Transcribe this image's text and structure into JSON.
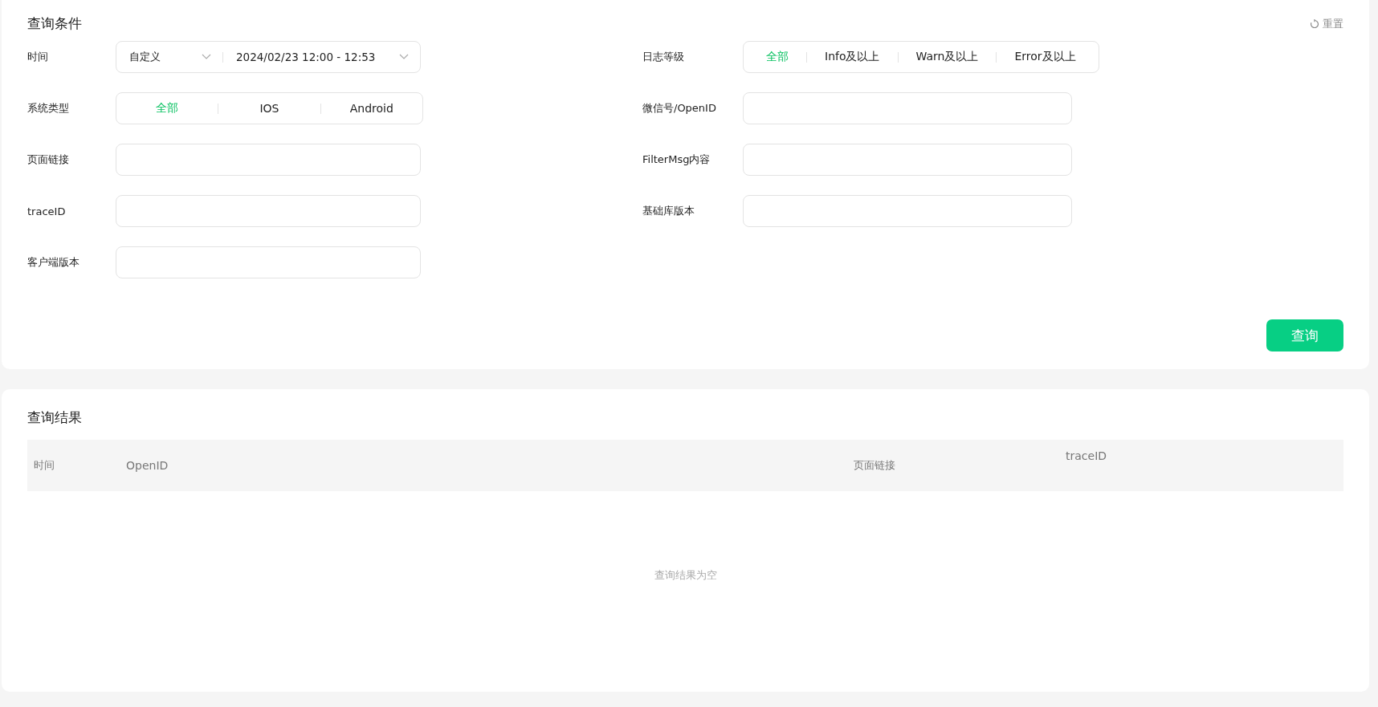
{
  "query_panel": {
    "title": "查询条件",
    "reset_button": "重置",
    "left_fields": [
      {
        "kind": "date-range",
        "label": "时间",
        "preset": "自定义",
        "range": "2024/02/23 12:00 - 12:53"
      },
      {
        "kind": "segmented",
        "label": "系统类型",
        "options": [
          {
            "label": "全部",
            "selected": true
          },
          {
            "label": "IOS",
            "selected": false
          },
          {
            "label": "Android",
            "selected": false
          }
        ]
      },
      {
        "kind": "text",
        "label": "页面链接"
      },
      {
        "kind": "text",
        "label": "traceID"
      },
      {
        "kind": "text",
        "label": "客户端版本"
      }
    ],
    "right_fields": [
      {
        "kind": "segmented",
        "label": "日志等级",
        "options": [
          {
            "label": "全部",
            "selected": true
          },
          {
            "label": "Info及以上",
            "selected": false
          },
          {
            "label": "Warn及以上",
            "selected": false
          },
          {
            "label": "Error及以上",
            "selected": false
          }
        ]
      },
      {
        "kind": "text",
        "label": "微信号/OpenID"
      },
      {
        "kind": "text",
        "label": "FilterMsg内容"
      },
      {
        "kind": "text",
        "label": "基础库版本"
      }
    ],
    "submit_button": "查询"
  },
  "results_panel": {
    "title": "查询结果",
    "columns": [
      "时间",
      "OpenID",
      "页面链接",
      "traceID"
    ],
    "empty_text": "查询结果为空"
  }
}
